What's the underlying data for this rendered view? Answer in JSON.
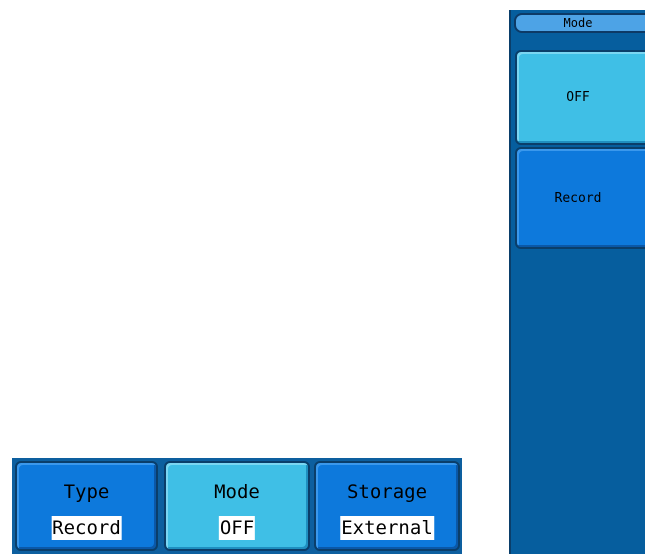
{
  "side_menu": {
    "header": "Mode",
    "options": [
      {
        "label": "OFF",
        "selected": true
      },
      {
        "label": "Record",
        "selected": false
      }
    ]
  },
  "softkeys": [
    {
      "title": "Type",
      "value": "Record",
      "active": false
    },
    {
      "title": "Mode",
      "value": "OFF",
      "active": true
    },
    {
      "title": "Storage",
      "value": "External",
      "active": false
    }
  ],
  "colors": {
    "panel_bg": "#065e9e",
    "button_blue": "#0d79dc",
    "button_selected": "#3fbfe6",
    "header_bg": "#4da3e6"
  }
}
